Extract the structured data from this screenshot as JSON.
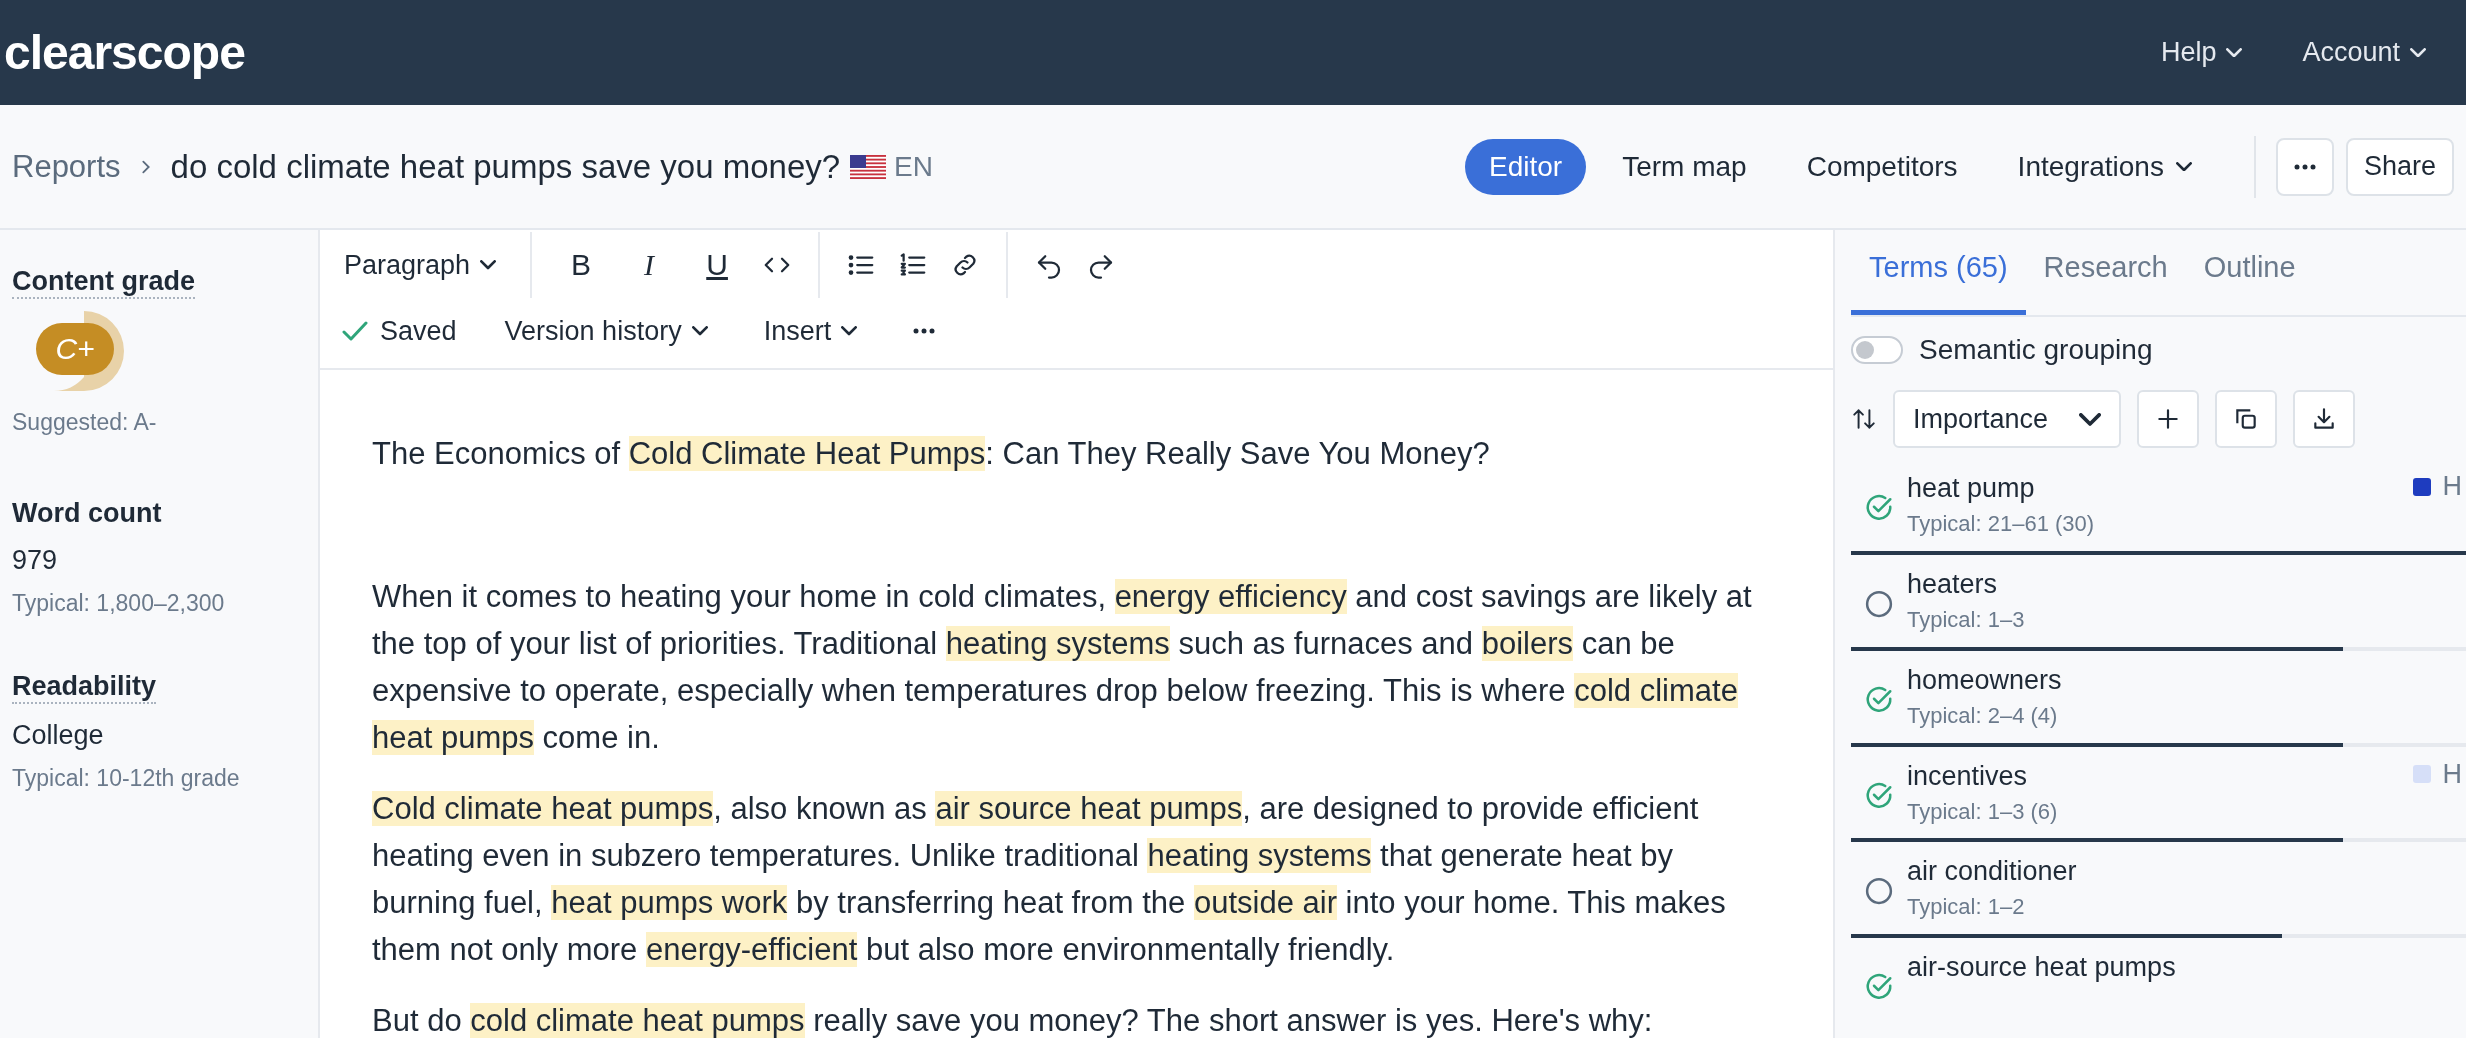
{
  "topbar": {
    "logo": "clearscope",
    "menus": [
      {
        "label": "Help"
      },
      {
        "label": "Account"
      }
    ]
  },
  "breadcrumb": {
    "root": "Reports",
    "title": "do cold climate heat pumps save you money?",
    "language": "EN"
  },
  "view_tabs": [
    {
      "label": "Editor",
      "selected": true
    },
    {
      "label": "Term map",
      "selected": false
    },
    {
      "label": "Competitors",
      "selected": false
    },
    {
      "label": "Integrations",
      "selected": false,
      "dropdown": true
    }
  ],
  "share_button": "Share",
  "sidebar": {
    "content_grade": {
      "label": "Content grade",
      "grade": "C+",
      "suggested": "Suggested: A-"
    },
    "word_count": {
      "label": "Word count",
      "value": "979",
      "typical": "Typical: 1,800–2,300"
    },
    "readability": {
      "label": "Readability",
      "value": "College",
      "typical": "Typical: 10-12th grade"
    }
  },
  "toolbar": {
    "block_style": "Paragraph",
    "format_buttons": [
      "B",
      "I",
      "U"
    ],
    "status": "Saved",
    "menus": [
      "Version history",
      "Insert"
    ]
  },
  "document": {
    "title": [
      {
        "text": "The Economics of ",
        "highlighted": false
      },
      {
        "text": "Cold Climate Heat Pumps",
        "highlighted": true
      },
      {
        "text": ": Can They Really Save You Money?",
        "highlighted": false
      }
    ],
    "paragraphs": [
      [
        {
          "text": "When it comes to heating your home in cold climates, ",
          "highlighted": false
        },
        {
          "text": "energy efficiency",
          "highlighted": true
        },
        {
          "text": " and cost savings are likely at the top of your list of priorities. Traditional ",
          "highlighted": false
        },
        {
          "text": "heating systems",
          "highlighted": true
        },
        {
          "text": " such as furnaces and ",
          "highlighted": false
        },
        {
          "text": "boilers",
          "highlighted": true
        },
        {
          "text": " can be expensive to operate, especially when temperatures drop below freezing. This is where ",
          "highlighted": false
        },
        {
          "text": "cold climate heat pumps",
          "highlighted": true
        },
        {
          "text": " come in.",
          "highlighted": false
        }
      ],
      [
        {
          "text": "Cold climate heat pumps",
          "highlighted": true
        },
        {
          "text": ", also known as ",
          "highlighted": false
        },
        {
          "text": "air source heat pumps",
          "highlighted": true
        },
        {
          "text": ", are designed to provide efficient heating even in subzero temperatures. Unlike traditional ",
          "highlighted": false
        },
        {
          "text": "heating systems",
          "highlighted": true
        },
        {
          "text": " that generate heat by burning fuel, ",
          "highlighted": false
        },
        {
          "text": "heat pumps work",
          "highlighted": true
        },
        {
          "text": " by transferring heat from the ",
          "highlighted": false
        },
        {
          "text": "outside air",
          "highlighted": true
        },
        {
          "text": " into your home. This makes them not only more ",
          "highlighted": false
        },
        {
          "text": "energy-efficient",
          "highlighted": true
        },
        {
          "text": " but also more environmentally friendly.",
          "highlighted": false
        }
      ],
      [
        {
          "text": "But do ",
          "highlighted": false
        },
        {
          "text": "cold climate heat pumps",
          "highlighted": true
        },
        {
          "text": " really save you money? The short answer is yes. Here's why:",
          "highlighted": false
        }
      ]
    ]
  },
  "terms_panel": {
    "tabs": [
      {
        "label": "Terms (65)",
        "selected": true
      },
      {
        "label": "Research",
        "selected": false
      },
      {
        "label": "Outline",
        "selected": false
      }
    ],
    "semantic_grouping": {
      "label": "Semantic grouping",
      "on": false
    },
    "sort": "Importance",
    "terms": [
      {
        "name": "heat pump",
        "typical": "Typical: 21–61 (30)",
        "checked": true,
        "level": 1,
        "tag": {
          "label": "H",
          "color": "#1e3cbf"
        }
      },
      {
        "name": "heaters",
        "typical": "Typical: 1–3",
        "checked": false,
        "level": 0.8
      },
      {
        "name": "homeowners",
        "typical": "Typical: 2–4 (4)",
        "checked": true,
        "level": 0.8
      },
      {
        "name": "incentives",
        "typical": "Typical: 1–3 (6)",
        "checked": true,
        "level": 0.8,
        "tag": {
          "label": "H",
          "color": "#d6dff8"
        }
      },
      {
        "name": "air conditioner",
        "typical": "Typical: 1–2",
        "checked": false,
        "level": 0.7
      },
      {
        "name": "air-source heat pumps",
        "checked": true
      }
    ]
  }
}
